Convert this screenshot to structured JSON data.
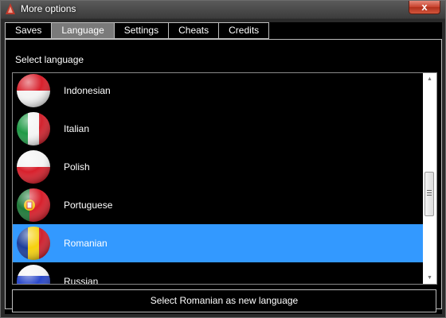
{
  "window": {
    "title": "More options",
    "close_glyph": "x"
  },
  "tabs": [
    {
      "label": "Saves"
    },
    {
      "label": "Language",
      "active": true
    },
    {
      "label": "Settings"
    },
    {
      "label": "Cheats"
    },
    {
      "label": "Credits"
    }
  ],
  "panel": {
    "label": "Select language"
  },
  "languages": [
    {
      "label": "Indonesian",
      "flag": "indonesia-flag-icon"
    },
    {
      "label": "Italian",
      "flag": "italy-flag-icon"
    },
    {
      "label": "Polish",
      "flag": "poland-flag-icon"
    },
    {
      "label": "Portuguese",
      "flag": "portugal-flag-icon"
    },
    {
      "label": "Romanian",
      "flag": "romania-flag-icon",
      "selected": true
    },
    {
      "label": "Russian",
      "flag": "russia-flag-icon"
    }
  ],
  "action": {
    "label": "Select Romanian as new language"
  },
  "colors": {
    "selection": "#3399ff",
    "background": "#000000"
  }
}
